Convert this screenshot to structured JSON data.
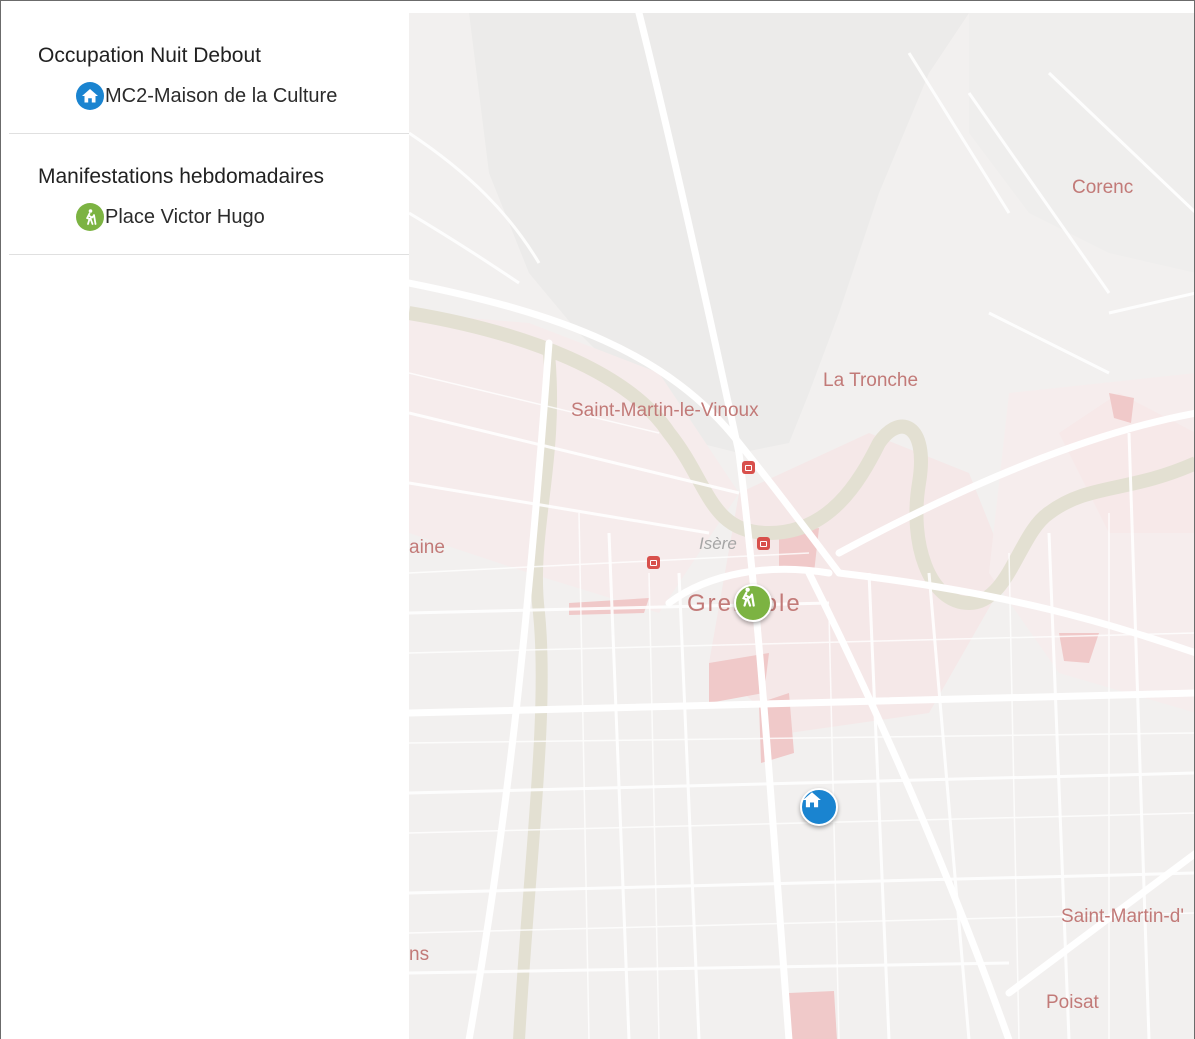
{
  "sidebar": {
    "groups": [
      {
        "title": "Occupation Nuit Debout",
        "place": {
          "label": "MC2-Maison de la Culture",
          "icon": "home-icon",
          "color": "#1a84d0"
        }
      },
      {
        "title": "Manifestations hebdomadaires",
        "place": {
          "label": "Place Victor Hugo",
          "icon": "hiker-icon",
          "color": "#7cb342"
        }
      }
    ]
  },
  "map": {
    "labels": {
      "corenc": "Corenc",
      "la_tronche": "La Tronche",
      "saint_martin_le_vinoux": "Saint-Martin-le-Vinoux",
      "isere": "Isère",
      "fontaine": "aine",
      "grenoble": "Grenoble",
      "seyssins": "ns",
      "saint_martin_d": "Saint-Martin-d'",
      "poisat": "Poisat"
    },
    "colors": {
      "background": "#f2f0ef",
      "road": "#ffffff",
      "river": "#e3e0d2",
      "urban": "#f3d3d3",
      "label": "#c27a78"
    }
  }
}
